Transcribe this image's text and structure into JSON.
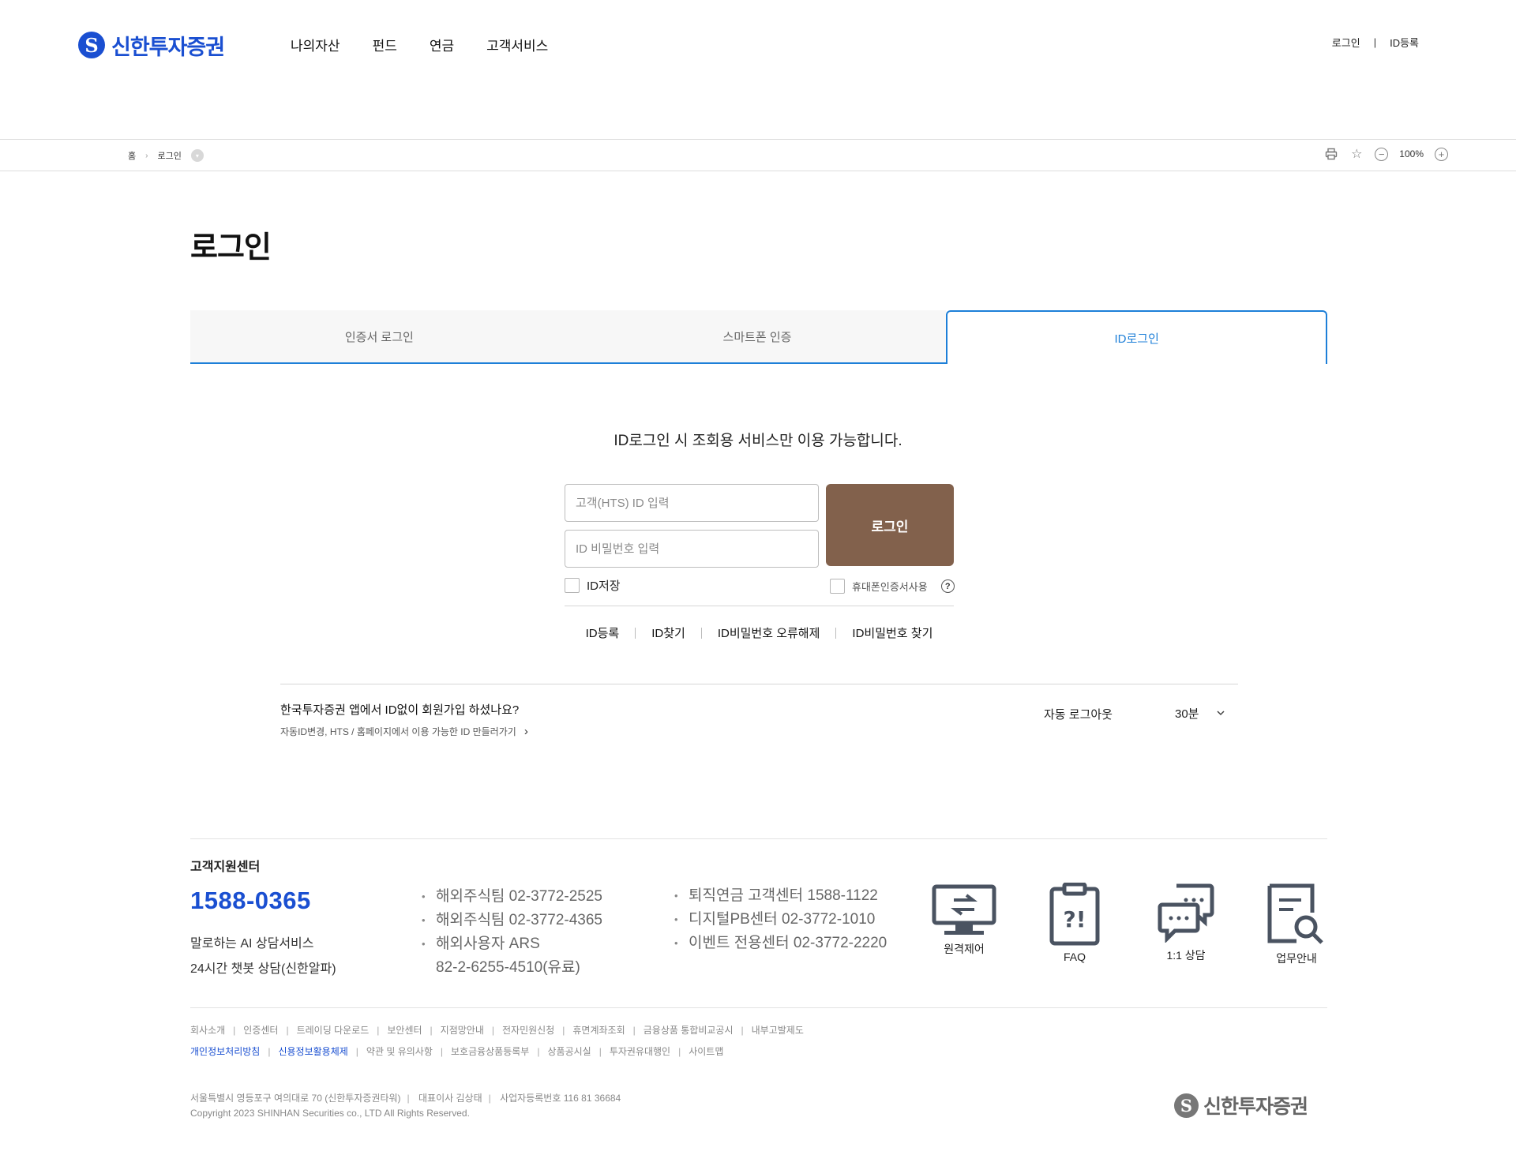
{
  "header": {
    "logo_mark": "S",
    "logo_text": "신한투자증권",
    "nav": [
      "나의자산",
      "펀드",
      "연금",
      "고객서비스"
    ],
    "util": {
      "login": "로그인",
      "register": "ID등록",
      "sep": "|"
    }
  },
  "breadcrumb": {
    "home": "홈",
    "arrow": "›",
    "current": "로그인",
    "dropdown_icon": "▾"
  },
  "tools": {
    "print_icon": "⎙",
    "star_icon": "☆",
    "zoom_out": "−",
    "zoom": "100%",
    "zoom_in": "+"
  },
  "page": {
    "title": "로그인"
  },
  "tabs": [
    {
      "label": "인증서 로그인",
      "active": false
    },
    {
      "label": "스마트폰 인증",
      "active": false
    },
    {
      "label": "ID로그인",
      "active": true
    }
  ],
  "login": {
    "notice": "ID로그인 시 조회용 서비스만 이용 가능합니다.",
    "id_placeholder": "고객(HTS) ID 입력",
    "pw_placeholder": "ID 비밀번호 입력",
    "button": "로그인",
    "save_id": "ID저장",
    "mobile_cert": "휴대폰인증서사용",
    "help": "?",
    "links": [
      "ID등록",
      "ID찾기",
      "ID비밀번호 오류해제",
      "ID비밀번호 찾기"
    ]
  },
  "promo": {
    "title": "한국투자증권 앱에서 ID없이 회원가입 하셨나요?",
    "link": "자동ID변경, HTS / 홈페이지에서 이용 가능한 ID 만들러가기",
    "link_arrow": "›"
  },
  "autologout": {
    "label": "자동 로그아웃",
    "value": "30분",
    "chevron": "⌄"
  },
  "footer": {
    "cs_title": "고객지원센터",
    "cs_phone": "1588-0365",
    "cs_ai": [
      "말로하는 AI 상담서비스",
      "24시간 챗봇 상담(신한알파)"
    ],
    "list1": [
      "해외주식팀 02-3772-2525",
      "해외주식팀 02-3772-4365",
      "해외사용자 ARS",
      "82-2-6255-4510(유료)"
    ],
    "list2": [
      "퇴직연금 고객센터 1588-1122",
      "디지털PB센터 02-3772-1010",
      "이벤트 전용센터 02-3772-2220"
    ],
    "quick": [
      {
        "label": "원격제어",
        "icon": "remote-control-icon"
      },
      {
        "label": "FAQ",
        "icon": "faq-icon",
        "glyph": "?!"
      },
      {
        "label": "1:1 상담",
        "icon": "chat-consult-icon"
      },
      {
        "label": "업무안내",
        "icon": "document-search-icon"
      }
    ],
    "links_row1": [
      "회사소개",
      "인증센터",
      "트레이딩 다운로드",
      "보안센터",
      "지점망안내",
      "전자민원신청",
      "휴면계좌조회",
      "금융상품 통합비교공시",
      "내부고발제도"
    ],
    "links_row2_highlight": [
      "개인정보처리방침",
      "신용정보활용체제"
    ],
    "links_row2": [
      "약관 및 유의사항",
      "보호금융상품등록부",
      "상품공시실",
      "투자권유대행인",
      "사이트맵"
    ],
    "address": "서울특별시 영등포구 여의대로 70 (신한투자증권타워)",
    "ceo": "대표이사 김상태",
    "biz_no": "사업자등록번호 116 81 36684",
    "copyright": "Copyright 2023 SHINHAN Securities co., LTD All Rights Reserved.",
    "sep": "|",
    "logo_mark": "S",
    "logo_text": "신한투자증권"
  },
  "colors": {
    "brand": "#1a4fd1",
    "tab_active": "#1d7fd8",
    "login_button": "#82614c"
  }
}
